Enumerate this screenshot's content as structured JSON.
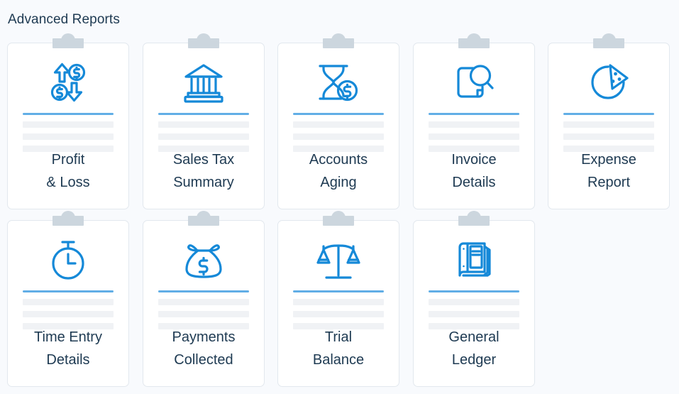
{
  "page": {
    "title": "Advanced Reports",
    "background_color": "#f8fafd",
    "title_color": "#1e3a52",
    "accent_color": "#1589d8",
    "divider_color": "#61aee6",
    "clip_color": "#ccd6de",
    "skeleton_color": "#f0f2f5",
    "card_border_color": "#e2e8ee",
    "card_background": "#ffffff"
  },
  "cards": [
    {
      "id": "profit-and-loss",
      "icon": "arrows-up-down-dollar-icon",
      "label_line1": "Profit",
      "label_line2": "& Loss"
    },
    {
      "id": "sales-tax-summary",
      "icon": "bank-building-icon",
      "label_line1": "Sales Tax",
      "label_line2": "Summary"
    },
    {
      "id": "accounts-aging",
      "icon": "hourglass-dollar-icon",
      "label_line1": "Accounts",
      "label_line2": "Aging"
    },
    {
      "id": "invoice-details",
      "icon": "document-magnifier-icon",
      "label_line1": "Invoice",
      "label_line2": "Details"
    },
    {
      "id": "expense-report",
      "icon": "pie-chart-slice-icon",
      "label_line1": "Expense",
      "label_line2": "Report"
    },
    {
      "id": "time-entry-details",
      "icon": "stopwatch-icon",
      "label_line1": "Time Entry",
      "label_line2": "Details"
    },
    {
      "id": "payments-collected",
      "icon": "money-bag-icon",
      "label_line1": "Payments",
      "label_line2": "Collected"
    },
    {
      "id": "trial-balance",
      "icon": "balance-scale-icon",
      "label_line1": "Trial",
      "label_line2": "Balance"
    },
    {
      "id": "general-ledger",
      "icon": "ledger-book-icon",
      "label_line1": "General",
      "label_line2": "Ledger"
    }
  ]
}
